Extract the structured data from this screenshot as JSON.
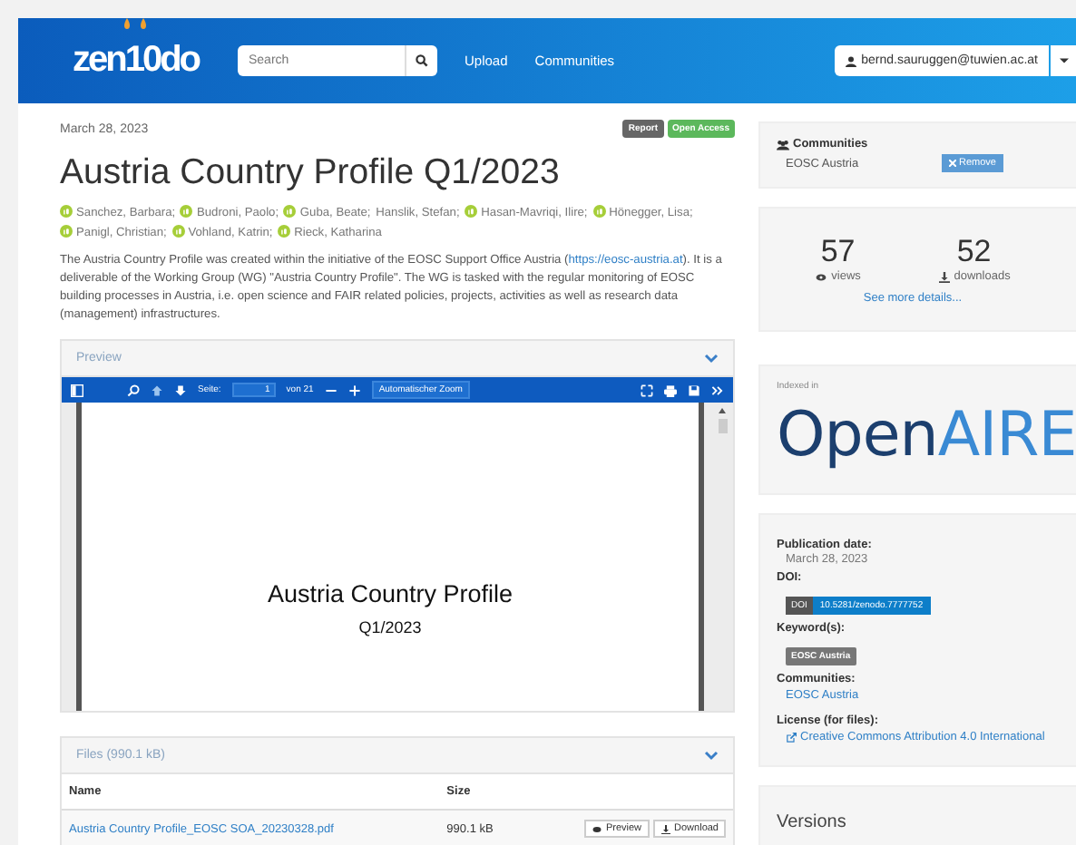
{
  "header": {
    "logo": "zen10do",
    "search": {
      "placeholder": "Search"
    },
    "nav": [
      "Upload",
      "Communities"
    ],
    "user": "bernd.sauruggen@tuwien.ac.at"
  },
  "record": {
    "date": "March 28, 2023",
    "badges": [
      {
        "label": "Report",
        "kind": "type"
      },
      {
        "label": "Open Access",
        "kind": "access"
      }
    ],
    "title": "Austria Country Profile Q1/2023",
    "authors": [
      {
        "name": "Sanchez, Barbara;",
        "orcid": true
      },
      {
        "name": "Budroni, Paolo;",
        "orcid": true
      },
      {
        "name": "Guba, Beate;",
        "orcid": true
      },
      {
        "name": "Hanslik, Stefan;",
        "orcid": false
      },
      {
        "name": "Hasan-Mavriqi, Ilire;",
        "orcid": true
      },
      {
        "name": "Hönegger, Lisa;",
        "orcid": true
      },
      {
        "name": "Panigl, Christian;",
        "orcid": true
      },
      {
        "name": "Vohland, Katrin;",
        "orcid": true
      },
      {
        "name": "Rieck, Katharina",
        "orcid": true
      }
    ],
    "description": {
      "before": "The Austria Country Profile was created within the initiative of the EOSC Support Office Austria (",
      "link": "https://eosc-austria.at",
      "after": "). It is a deliverable of the Working Group (WG) \"Austria Country Profile\". The WG is tasked with the regular monitoring of EOSC building processes in Austria, i.e. open science and FAIR related policies, projects, activities as well as research data (management) infrastructures."
    }
  },
  "preview": {
    "title": "Preview",
    "toolbar": {
      "page_label": "Seite:",
      "page": "1",
      "page_count": "von 21",
      "zoom": "Automatischer Zoom"
    },
    "page": {
      "title": "Austria Country Profile",
      "subtitle": "Q1/2023"
    }
  },
  "files": {
    "title": "Files (990.1 kB)",
    "columns": [
      "Name",
      "Size"
    ],
    "rows": [
      {
        "name": "Austria Country Profile_EOSC SOA_20230328.pdf",
        "size": "990.1 kB",
        "actions": [
          {
            "label": "Preview",
            "kind": "preview"
          },
          {
            "label": "Download",
            "kind": "download"
          }
        ]
      }
    ]
  },
  "sidebar": {
    "communities": {
      "title": "Communities",
      "items": [
        {
          "name": "EOSC Austria",
          "action": "Remove"
        }
      ]
    },
    "stats": [
      {
        "value": "57",
        "label": "views",
        "kind": "views"
      },
      {
        "value": "52",
        "label": "downloads",
        "kind": "downloads"
      }
    ],
    "stats_link": "See more details...",
    "indexed": {
      "label": "Indexed in",
      "logo": [
        "Open",
        "AIRE"
      ]
    },
    "details": {
      "publication_date_label": "Publication date:",
      "publication_date": "March 28, 2023",
      "doi_label": "DOI:",
      "doi_tag": "DOI",
      "doi": "10.5281/zenodo.7777752",
      "keywords_label": "Keyword(s):",
      "keywords": [
        "EOSC Austria"
      ],
      "communities_label": "Communities:",
      "communities": [
        "EOSC Austria"
      ],
      "license_label": "License (for files):",
      "license": "Creative Commons Attribution 4.0 International"
    },
    "versions": "Versions"
  }
}
